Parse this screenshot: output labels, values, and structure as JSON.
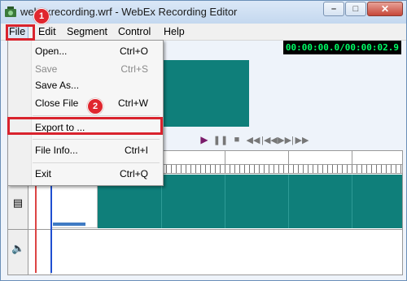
{
  "window": {
    "title": "webexrecording.wrf - WebEx Recording Editor",
    "minimize_glyph": "–",
    "maximize_glyph": "□",
    "close_glyph": "✕"
  },
  "menubar": [
    "File",
    "Edit",
    "Segment",
    "Control",
    "Help"
  ],
  "timecode": "00:00:00.0/00:00:02.9",
  "file_menu": [
    {
      "label": "Open...",
      "shortcut": "Ctrl+O",
      "enabled": true
    },
    {
      "label": "Save",
      "shortcut": "Ctrl+S",
      "enabled": false
    },
    {
      "label": "Save As...",
      "shortcut": "",
      "enabled": true
    },
    {
      "label": "Close File",
      "shortcut": "Ctrl+W",
      "enabled": true
    },
    {
      "label": "Export to ...",
      "shortcut": "",
      "enabled": true
    },
    {
      "label": "File Info...",
      "shortcut": "Ctrl+I",
      "enabled": true
    },
    {
      "label": "Exit",
      "shortcut": "Ctrl+Q",
      "enabled": true
    }
  ],
  "annotations": {
    "badge1": "1",
    "badge2": "2"
  },
  "playback_icons": [
    "play-icon",
    "pause-icon",
    "stop-icon",
    "rewind-icon",
    "skip-back-icon",
    "skip-forward-icon",
    "fast-forward-icon"
  ],
  "colors": {
    "accent_red": "#d9232d",
    "video_teal": "#0f7f7a",
    "timecode_green": "#00ff66"
  }
}
